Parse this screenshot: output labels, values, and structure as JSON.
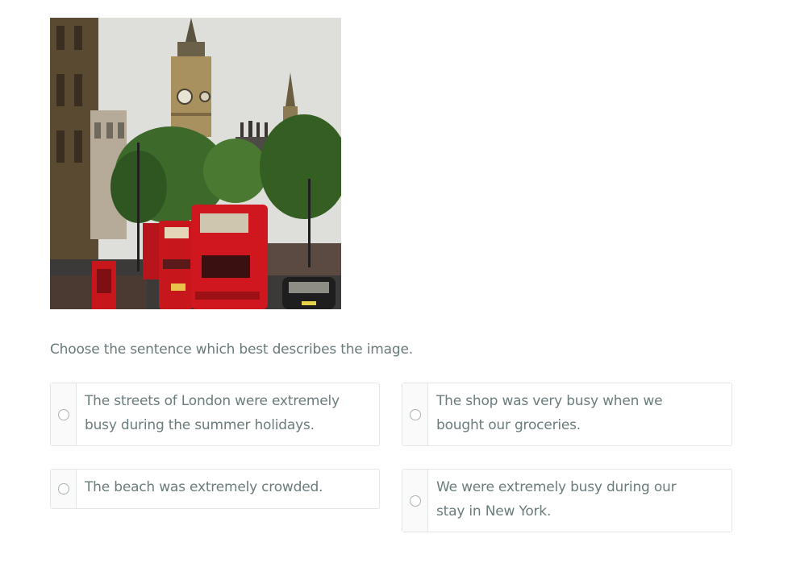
{
  "question": {
    "prompt": "Choose the sentence which best describes the image."
  },
  "image": {
    "subject": "london-street-photo"
  },
  "options": [
    {
      "label": "The streets of London were extremely busy during the summer holidays."
    },
    {
      "label": "The shop was very busy when we bought our groceries."
    },
    {
      "label": "The beach was extremely crowded."
    },
    {
      "label": "We were extremely busy during our stay in New York."
    }
  ],
  "colors": {
    "text": "#6a7c7c",
    "border": "#e3e6e6",
    "bus_red": "#c8161d"
  }
}
